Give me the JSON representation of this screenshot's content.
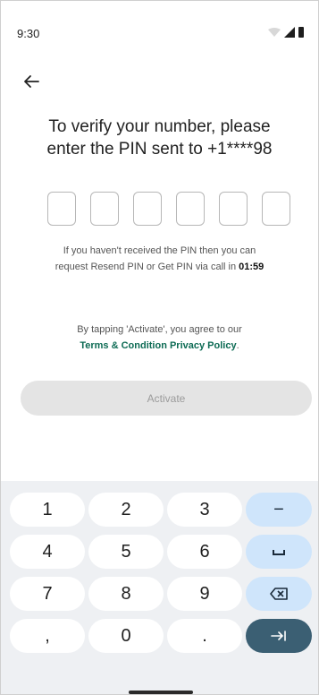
{
  "status_bar": {
    "time": "9:30"
  },
  "screen": {
    "title": "To verify your number, please\nenter the PIN sent to +1****98",
    "pin_boxes": 6,
    "resend_text": "If you haven't received the PIN then you can\nrequest Resend PIN or Get PIN via call in ",
    "resend_timer": "01:59",
    "terms_prefix": "By tapping 'Activate', you agree to our",
    "terms_link": "Terms & Condition Privacy Policy",
    "terms_suffix": ".",
    "activate_label": "Activate"
  },
  "keyboard": {
    "rows": [
      [
        "1",
        "2",
        "3",
        "−"
      ],
      [
        "4",
        "5",
        "6",
        "␣"
      ],
      [
        "7",
        "8",
        "9",
        "⌫"
      ],
      [
        ",",
        "0",
        ".",
        "→|"
      ]
    ]
  },
  "icons": [
    "wifi-icon",
    "signal-icon",
    "battery-icon",
    "back-arrow-icon",
    "space-icon",
    "backspace-icon",
    "next-icon"
  ]
}
